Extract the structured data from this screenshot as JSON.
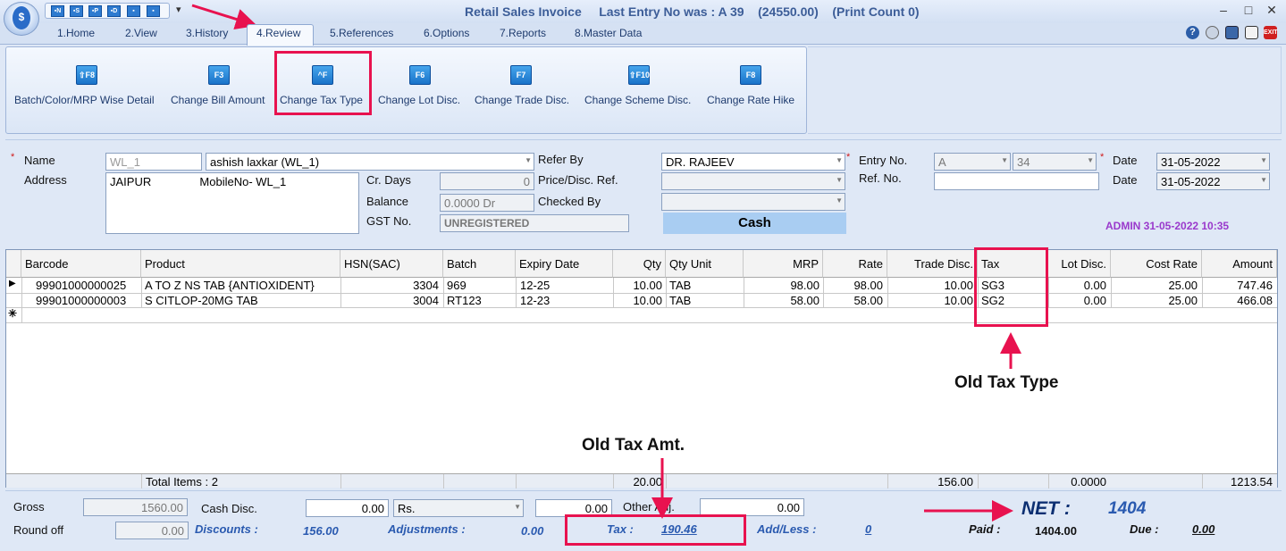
{
  "window": {
    "title": "Retail Sales Invoice",
    "last_entry": "Last Entry No was : A 39",
    "amount_info": "(24550.00)",
    "print_count": "(Print Count 0)"
  },
  "quick_access": [
    "N",
    "S",
    "P",
    "D",
    "",
    ""
  ],
  "tabs": [
    {
      "label": "1.Home"
    },
    {
      "label": "2.View"
    },
    {
      "label": "3.History"
    },
    {
      "label": "4.Review",
      "active": true
    },
    {
      "label": "5.References"
    },
    {
      "label": "6.Options"
    },
    {
      "label": "7.Reports"
    },
    {
      "label": "8.Master Data"
    }
  ],
  "ribbon": {
    "buttons": [
      {
        "label": "Batch/Color/MRP Wise Detail",
        "key": "⇧F8",
        "icon": "f8-key-icon"
      },
      {
        "label": "Change Bill Amount",
        "key": "F3",
        "icon": "f3-key-icon"
      },
      {
        "label": "Change Tax Type",
        "key": "^F",
        "icon": "ctrl-f-key-icon"
      },
      {
        "label": "Change Lot Disc.",
        "key": "F6",
        "icon": "f6-key-icon"
      },
      {
        "label": "Change Trade Disc.",
        "key": "F7",
        "icon": "f7-key-icon"
      },
      {
        "label": "Change Scheme Disc.",
        "key": "⇧F10",
        "icon": "f10-key-icon"
      },
      {
        "label": "Change Rate Hike",
        "key": "F8",
        "icon": "f8-key-icon"
      }
    ]
  },
  "form": {
    "name_label": "Name",
    "name_code": "WL_1",
    "name_value": "ashish laxkar (WL_1)",
    "address_label": "Address",
    "address_value": "JAIPUR               MobileNo- WL_1",
    "cr_days_label": "Cr. Days",
    "cr_days_value": "0",
    "balance_label": "Balance",
    "balance_value": "0.0000 Dr",
    "gst_label": "GST No.",
    "gst_value": "UNREGISTERED",
    "refer_by_label": "Refer By",
    "refer_by_value": "DR. RAJEEV",
    "price_disc_label": "Price/Disc. Ref.",
    "checked_by_label": "Checked By",
    "cash_label": "Cash",
    "entry_no_label": "Entry No.",
    "entry_series": "A",
    "entry_number": "34",
    "ref_no_label": "Ref. No.",
    "date_label": "Date",
    "date_value": "31-05-2022",
    "date2_label": "Date",
    "date2_value": "31-05-2022",
    "admin_stamp": "ADMIN 31-05-2022 10:35"
  },
  "grid": {
    "columns": [
      "Barcode",
      "Product",
      "HSN(SAC)",
      "Batch",
      "Expiry Date",
      "Qty",
      "Qty Unit",
      "MRP",
      "Rate",
      "Trade Disc.",
      "Tax",
      "Lot Disc.",
      "Cost Rate",
      "Amount"
    ],
    "rows": [
      [
        "99901000000025",
        "A TO Z NS TAB {ANTIOXIDENT}",
        "3304",
        "969",
        "12-25",
        "10.00",
        "TAB",
        "98.00",
        "98.00",
        "10.00",
        "SG3",
        "0.00",
        "25.00",
        "747.46"
      ],
      [
        "99901000000003",
        "S CITLOP-20MG TAB",
        "3004",
        "RT123",
        "12-23",
        "10.00",
        "TAB",
        "58.00",
        "58.00",
        "10.00",
        "SG2",
        "0.00",
        "25.00",
        "466.08"
      ]
    ],
    "totals": {
      "items": "Total Items : 2",
      "qty": "20.00",
      "trade_disc": "156.00",
      "lot_disc": "0.0000",
      "amount": "1213.54"
    }
  },
  "footer": {
    "gross_label": "Gross",
    "gross_value": "1560.00",
    "cash_disc_label": "Cash Disc.",
    "cash_disc_value": "0.00",
    "cash_disc_unit": "Rs.",
    "cash_disc_amount": "0.00",
    "other_adj_label": "Other Adj.",
    "other_adj_value": "0.00",
    "round_off_label": "Round off",
    "round_off_value": "0.00",
    "discounts_label": "Discounts :",
    "discounts_value": "156.00",
    "adjustments_label": "Adjustments :",
    "adjustments_value": "0.00",
    "tax_label": "Tax :",
    "tax_value": "190.46",
    "add_less_label": "Add/Less :",
    "add_less_value": "0",
    "net_label": "NET :",
    "net_value": "1404",
    "paid_label": "Paid :",
    "paid_value": "1404.00",
    "due_label": "Due :",
    "due_value": "0.00"
  },
  "annotations": {
    "old_tax_type": "Old Tax Type",
    "old_tax_amt": "Old Tax Amt."
  },
  "colors": {
    "highlight": "#e8124f",
    "accent_blue": "#2a5ab0",
    "admin_purple": "#9a39cc"
  }
}
